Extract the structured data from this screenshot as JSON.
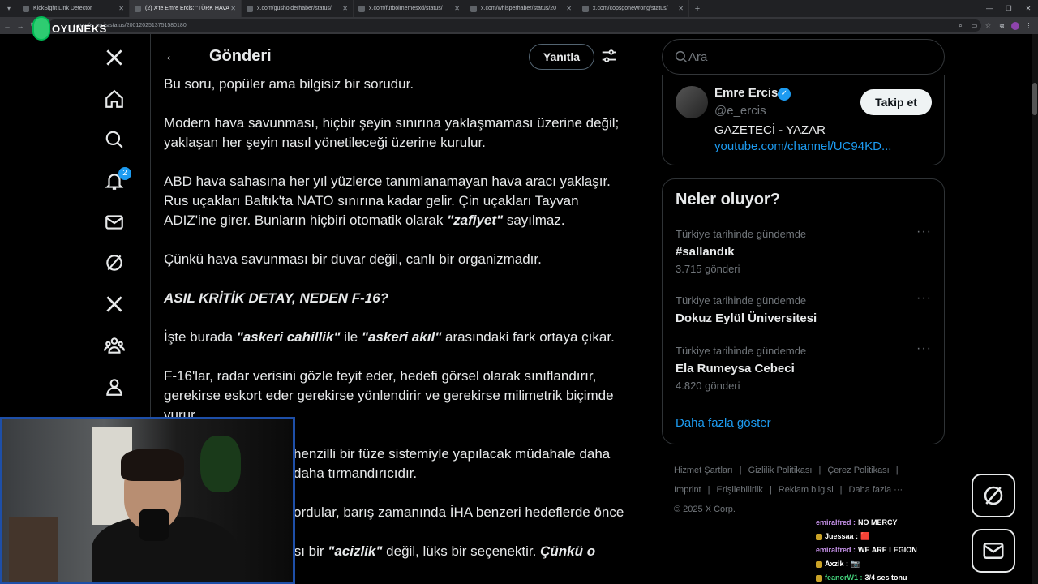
{
  "browser": {
    "tabs": [
      {
        "title": "KickSight Link Detector",
        "active": false
      },
      {
        "title": "(2) X'te Emre Ercis: \"TÜRK HAVA",
        "active": true
      },
      {
        "title": "x.com/gusholderhaber/status/",
        "active": false
      },
      {
        "title": "x.com/futbolmemesxd/status/",
        "active": false
      },
      {
        "title": "x.com/whisperhaber/status/20",
        "active": false
      },
      {
        "title": "x.com/copsgonewrong/status/",
        "active": false
      }
    ],
    "url": "x.com/e_ercis/status/2001202513751580180"
  },
  "overlay": {
    "brand": "OYUNEKS"
  },
  "nav": {
    "notification_count": "2"
  },
  "header": {
    "title": "Gönderi",
    "reply_label": "Yanıtla"
  },
  "post": {
    "p1": "Bu soru, popüler ama bilgisiz bir sorudur.",
    "p2": "Modern hava savunması, hiçbir şeyin sınırına yaklaşmaması üzerine değil; yaklaşan her şeyin nasıl yönetileceği üzerine kurulur.",
    "p3a": "ABD hava sahasına her yıl yüzlerce tanımlanamayan hava aracı yaklaşır. Rus uçakları Baltık'ta NATO sınırına kadar gelir. Çin uçakları Tayvan ADIZ'ine girer. Bunların hiçbiri otomatik olarak ",
    "p3q": "\"zafiyet\"",
    "p3b": " sayılmaz.",
    "p4": "Çünkü hava savunması bir duvar değil, canlı bir organizmadır.",
    "heading": "ASIL KRİTİK DETAY, NEDEN F-16?",
    "p5a": "İşte burada ",
    "p5q1": "\"askeri cahillik\"",
    "p5b": " ile ",
    "p5q2": "\"askeri akıl\"",
    "p5c": " arasındaki fark ortaya çıkar.",
    "p6": "F-16'lar, radar verisini gözle teyit eder, hedefi görsel olarak sınıflandırır, gerekirse eskort eder gerekirse yönlendirir ve gerekirse milimetrik biçimde vurur.",
    "p7": "henzilli bir füze sistemiyle yapılacak müdahale daha daha tırmandırıcıdır.",
    "p8": "ordular, barış zamanında İHA benzeri hedeflerde önce",
    "p9a": "ısı bir ",
    "p9q": "\"acizlik\"",
    "p9b": " değil, lüks bir seçenektir. ",
    "p9c": "Çünkü o"
  },
  "search": {
    "placeholder": "Ara"
  },
  "profile": {
    "name": "Emre Ercis",
    "handle": "@e_ercis",
    "bio": "GAZETECİ - YAZAR",
    "link": "youtube.com/channel/UC94KD...",
    "follow_label": "Takip et"
  },
  "trends": {
    "title": "Neler oluyor?",
    "items": [
      {
        "context": "Türkiye tarihinde gündemde",
        "name": "#sallandık",
        "count": "3.715 gönderi"
      },
      {
        "context": "Türkiye tarihinde gündemde",
        "name": "Dokuz Eylül Üniversitesi",
        "count": ""
      },
      {
        "context": "Türkiye tarihinde gündemde",
        "name": "Ela Rumeysa Cebeci",
        "count": "4.820 gönderi"
      }
    ],
    "show_more": "Daha fazla göster"
  },
  "footer": {
    "links": [
      "Hizmet Şartları",
      "Gizlilik Politikası",
      "Çerez Politikası",
      "Imprint",
      "Erişilebilirlik",
      "Reklam bilgisi",
      "Daha fazla ···"
    ],
    "copyright": "© 2025 X Corp."
  },
  "chat": [
    {
      "user": "emiralfred",
      "msg": "NO MERCY",
      "color": "#c792ea",
      "icon": false
    },
    {
      "user": "Juessaa",
      "msg": "🟥",
      "color": "#ffffff",
      "icon": true
    },
    {
      "user": "emiralfred",
      "msg": "WE ARE LEGION",
      "color": "#c792ea",
      "icon": false
    },
    {
      "user": "Axzik",
      "msg": "📷",
      "color": "#ffffff",
      "icon": true
    },
    {
      "user": "feanorW1",
      "msg": "3/4 ses tonu",
      "color": "#43d17a",
      "icon": true
    }
  ]
}
